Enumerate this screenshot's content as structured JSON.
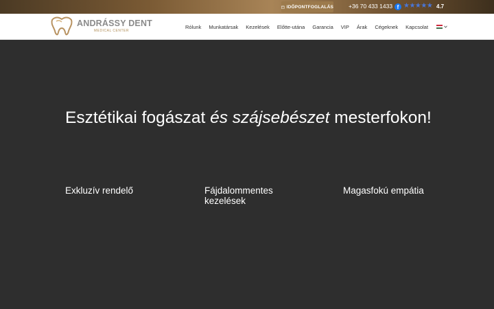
{
  "topbar": {
    "booking_label": "IDŐPONTFOGLALÁS",
    "phone": "+36 70 433 1433",
    "facebook_glyph": "f",
    "stars": "★★★★★",
    "rating": "4.7"
  },
  "header": {
    "logo_name": "ANDRÁSSY DENT",
    "logo_sub": "MEDICAL CENTER",
    "nav": [
      {
        "label": "Rólunk"
      },
      {
        "label": "Munkatársak"
      },
      {
        "label": "Kezelések"
      },
      {
        "label": "Előtte-utána"
      },
      {
        "label": "Garancia"
      },
      {
        "label": "VIP"
      },
      {
        "label": "Árak"
      },
      {
        "label": "Cégeknek"
      },
      {
        "label": "Kapcsolat"
      }
    ]
  },
  "hero": {
    "title_part1": "Esztétikai fogászat ",
    "title_em1": "és szájsebészet",
    "title_part2": " mesterfokon!",
    "features": [
      {
        "label": "Exkluzív rendelő"
      },
      {
        "label": "Fájdalommentes kezelések"
      },
      {
        "label": "Magasfokú empátia"
      }
    ]
  },
  "colors": {
    "gold": "#9c7a4c",
    "hero_bg": "#2e2e2e",
    "facebook": "#1877f2"
  }
}
